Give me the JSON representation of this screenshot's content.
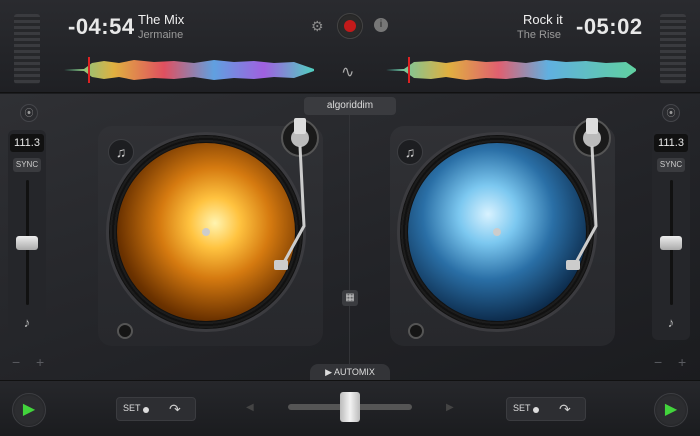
{
  "deck_left": {
    "time": "-04:54",
    "title": "The Mix",
    "artist": "Jermaine",
    "bpm": "111.3",
    "sync_label": "SYNC",
    "set_label": "SET"
  },
  "deck_right": {
    "time": "-05:02",
    "title": "Rock it",
    "artist": "The Rise",
    "bpm": "111.3",
    "sync_label": "SYNC",
    "set_label": "SET"
  },
  "logo_text": "algoriddim",
  "automix_label": "AUTOMIX",
  "colors": {
    "accent_green": "#42d43c",
    "record_red": "#c21a1a"
  },
  "icons": {
    "settings": "gear-icon",
    "record": "record-icon",
    "info": "info-icon",
    "waveform": "waveform-icon",
    "music": "music-note-icon",
    "play": "play-icon",
    "loop": "loop-icon",
    "grid": "grid-icon"
  }
}
